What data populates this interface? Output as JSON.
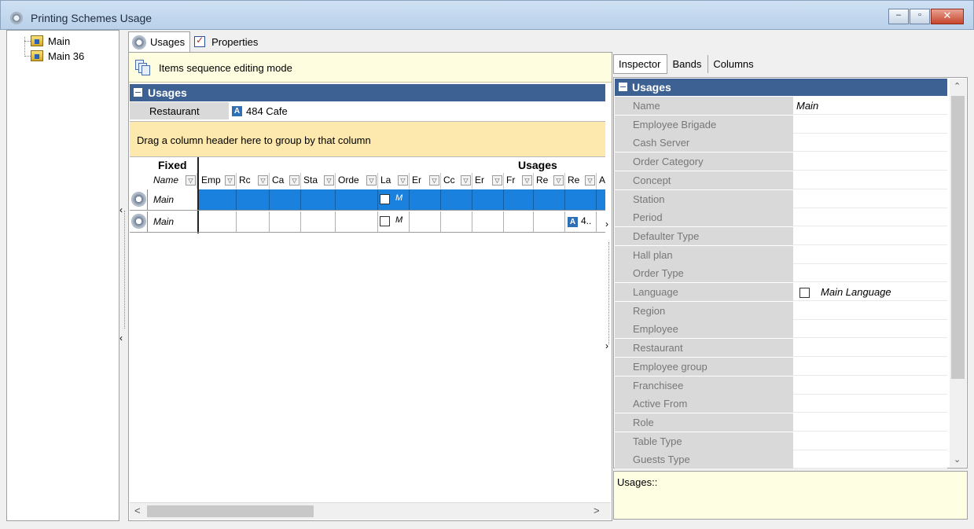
{
  "window": {
    "title": "Printing Schemes Usage",
    "minimize": "–",
    "restore": "▫",
    "close": "✕"
  },
  "tree": {
    "items": [
      {
        "label": "Main"
      },
      {
        "label": "Main 36"
      }
    ]
  },
  "center_tabs": [
    {
      "label": "Usages"
    },
    {
      "label": "Properties"
    }
  ],
  "sequence_mode": {
    "label": "Items sequence editing mode"
  },
  "usages_group": {
    "title": "Usages",
    "restaurant_label": "Restaurant",
    "restaurant_icon": "A",
    "restaurant_value": "484 Cafe"
  },
  "group_panel": {
    "text": "Drag a column header here to group by that column"
  },
  "grid": {
    "band_fixed": "Fixed",
    "band_usages": "Usages",
    "columns": [
      "Name",
      "Emp",
      "Rc",
      "Ca",
      "Sta",
      "Orde",
      "La",
      "Er",
      "Cc",
      "Er",
      "Fr",
      "Re",
      "Re",
      "A"
    ],
    "rows": [
      {
        "name": "Main",
        "lang": "M",
        "last": ""
      },
      {
        "name": "Main",
        "lang": "M",
        "last_icon": "A",
        "last": "4.."
      }
    ]
  },
  "right_tabs": [
    {
      "label": "Inspector"
    },
    {
      "label": "Bands"
    },
    {
      "label": "Columns"
    }
  ],
  "inspector": {
    "title": "Usages",
    "properties": [
      {
        "name": "Name",
        "value": "Main"
      },
      {
        "name": "Employee Brigade",
        "value": ""
      },
      {
        "name": "Cash Server",
        "value": ""
      },
      {
        "name": "Order Category",
        "value": ""
      },
      {
        "name": "Concept",
        "value": ""
      },
      {
        "name": "Station",
        "value": ""
      },
      {
        "name": "Period",
        "value": ""
      },
      {
        "name": "Defaulter Type",
        "value": ""
      },
      {
        "name": "Hall plan",
        "value": ""
      },
      {
        "name": "Order Type",
        "value": ""
      },
      {
        "name": "Language",
        "value": "Main Language"
      },
      {
        "name": "Region",
        "value": ""
      },
      {
        "name": "Employee",
        "value": ""
      },
      {
        "name": "Restaurant",
        "value": ""
      },
      {
        "name": "Employee group",
        "value": ""
      },
      {
        "name": "Franchisee",
        "value": ""
      },
      {
        "name": "Active From",
        "value": ""
      },
      {
        "name": "Role",
        "value": ""
      },
      {
        "name": "Table Type",
        "value": ""
      },
      {
        "name": "Guests Type",
        "value": ""
      }
    ]
  },
  "description": {
    "text": "Usages::"
  },
  "colors": {
    "accent_header": "#3d6193",
    "selection": "#1a82de",
    "hint_yellow": "#fefde0"
  }
}
